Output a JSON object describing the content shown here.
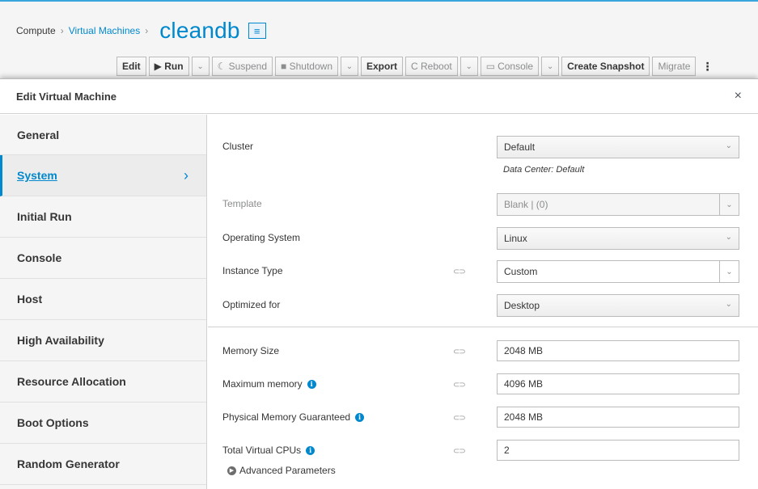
{
  "breadcrumb": {
    "root": "Compute",
    "section": "Virtual Machines",
    "vm_name": "cleandb",
    "title_btn_icon": "hamburger-icon"
  },
  "toolbar": {
    "edit": "Edit",
    "run": "▶ Run",
    "suspend": "☾ Suspend",
    "shutdown": "■ Shutdown",
    "export": "Export",
    "reboot": "C Reboot",
    "console": "Console",
    "create_snapshot": "Create Snapshot",
    "migrate": "Migrate",
    "caret": "⌄",
    "kebab": "⋮"
  },
  "modal": {
    "title": "Edit Virtual Machine",
    "close": "×"
  },
  "nav": {
    "items": [
      {
        "label": "General"
      },
      {
        "label": "System"
      },
      {
        "label": "Initial Run"
      },
      {
        "label": "Console"
      },
      {
        "label": "Host"
      },
      {
        "label": "High Availability"
      },
      {
        "label": "Resource Allocation"
      },
      {
        "label": "Boot Options"
      },
      {
        "label": "Random Generator"
      }
    ],
    "active_chevron": "›"
  },
  "form": {
    "cluster": {
      "label": "Cluster",
      "value": "Default",
      "note": "Data Center: Default"
    },
    "template": {
      "label": "Template",
      "value": "Blank | (0)"
    },
    "os": {
      "label": "Operating System",
      "value": "Linux"
    },
    "instance_type": {
      "label": "Instance Type",
      "value": "Custom"
    },
    "optimized": {
      "label": "Optimized for",
      "value": "Desktop"
    },
    "memory_size": {
      "label": "Memory Size",
      "value": "2048 MB"
    },
    "max_memory": {
      "label": "Maximum memory",
      "value": "4096 MB"
    },
    "phys_memory": {
      "label": "Physical Memory Guaranteed",
      "value": "2048 MB"
    },
    "vcpus": {
      "label": "Total Virtual CPUs",
      "value": "2"
    },
    "advanced": {
      "label": "Advanced Parameters"
    },
    "link_glyph": "⊂⊃",
    "info_glyph": "i",
    "caret": "⌄"
  },
  "colors": {
    "accent": "#0088ce"
  }
}
